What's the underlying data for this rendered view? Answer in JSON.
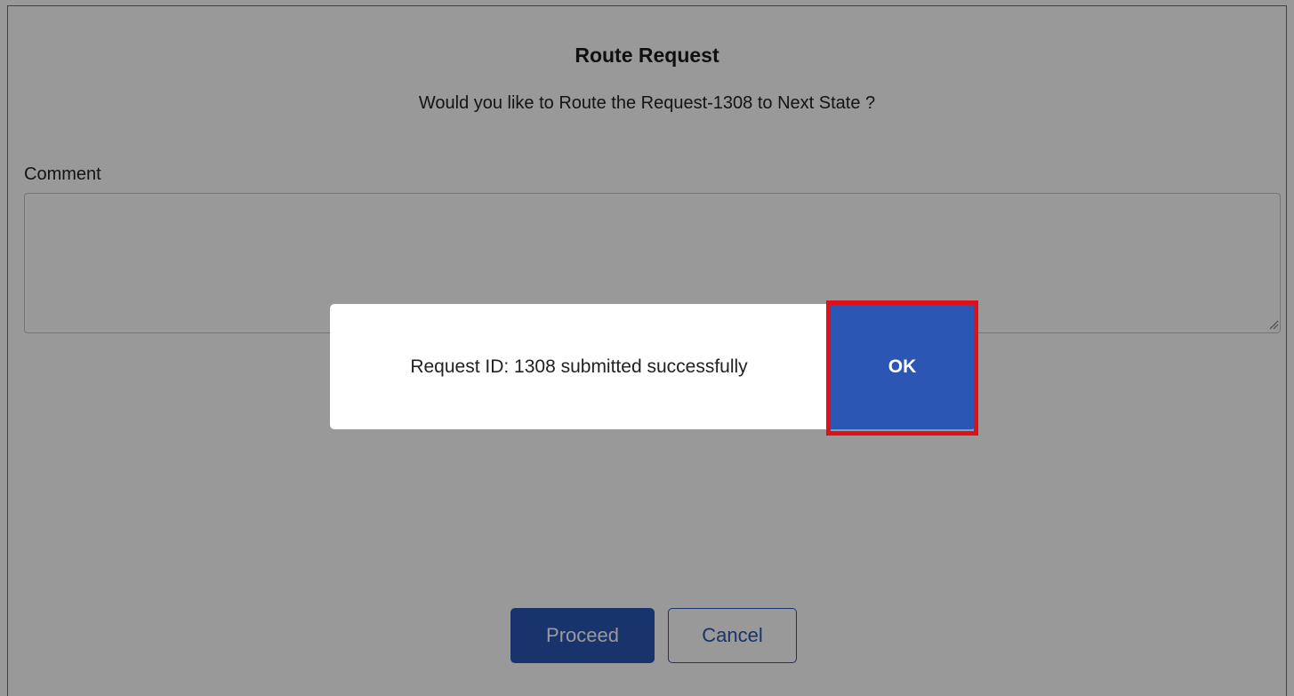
{
  "dialog": {
    "title": "Route Request",
    "subtitle": "Would you like to Route the Request-1308 to Next State ?",
    "comment_label": "Comment",
    "comment_value": "",
    "proceed_label": "Proceed",
    "cancel_label": "Cancel"
  },
  "toast": {
    "message": "Request ID: 1308 submitted successfully",
    "ok_label": "OK"
  },
  "colors": {
    "primary": "#2b56b4",
    "highlight": "#e0101a",
    "overlay": "rgba(0,0,0,0.4)"
  }
}
